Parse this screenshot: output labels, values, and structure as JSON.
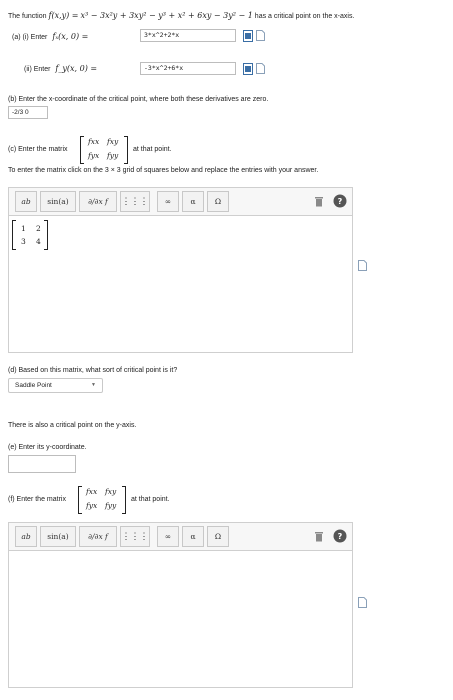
{
  "intro": {
    "prefix": "The function",
    "func_lhs": "f(x,y) =",
    "func_rhs": "x³ − 3x²y + 3xy² − y³ + x² + 6xy − 3y² − 1",
    "suffix": "has a critical point on the x-axis."
  },
  "part_a_i": {
    "label": "(a) (i)   Enter",
    "lhs": "fₓ(x, 0) =",
    "value": "3*x^2+2*x"
  },
  "part_a_ii": {
    "label": "(ii)   Enter",
    "lhs": "f_y(x, 0) =",
    "value": "-3*x^2+6*x"
  },
  "part_b": {
    "text": "(b) Enter the x-coordinate of the critical point, where both these derivatives are zero.",
    "value": "-2/3 0"
  },
  "part_c": {
    "prefix": "(c) Enter the matrix",
    "suffix": "at that point.",
    "instruction": "To enter the matrix click on the 3 × 3 grid of squares below and replace the entries with your answer."
  },
  "hessian_symbols": {
    "r1c1": "fxx",
    "r1c2": "fxy",
    "r2c1": "fyx",
    "r2c2": "fyy"
  },
  "toolbar": {
    "superscript_label": "ab",
    "sin_label": "sin(a)",
    "deriv_label": "∂/∂x f",
    "infinity_label": "∞",
    "alpha_label": "α",
    "omega_label": "Ω",
    "help_label": "?"
  },
  "editor1": {
    "matrix": [
      "1",
      "2",
      "3",
      "4"
    ]
  },
  "part_d": {
    "text": "(d) Based on this matrix, what sort of critical point is it?",
    "selected": "Saddle Point"
  },
  "y_axis_text": "There is also a critical point on the y-axis.",
  "part_e": {
    "text": "(e) Enter its y-coordinate.",
    "value": ""
  },
  "part_f": {
    "prefix": "(f) Enter the matrix",
    "suffix": "at that point."
  },
  "colors": {
    "border": "#bdbdbd",
    "accent_blue": "#3a6ea5",
    "delete_icon": "#8a8a8a"
  }
}
